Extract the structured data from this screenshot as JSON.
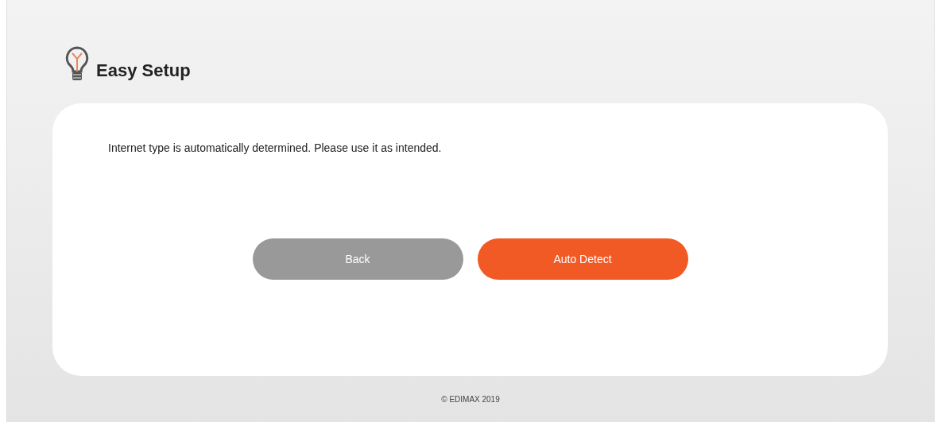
{
  "header": {
    "title": "Easy Setup"
  },
  "card": {
    "message": "Internet type is automatically determined. Please use it as intended.",
    "buttons": [
      {
        "label": "Back",
        "kind": "secondary"
      },
      {
        "label": "Auto Detect",
        "kind": "primary"
      }
    ]
  },
  "footer": {
    "copyright": "© EDIMAX 2019"
  }
}
